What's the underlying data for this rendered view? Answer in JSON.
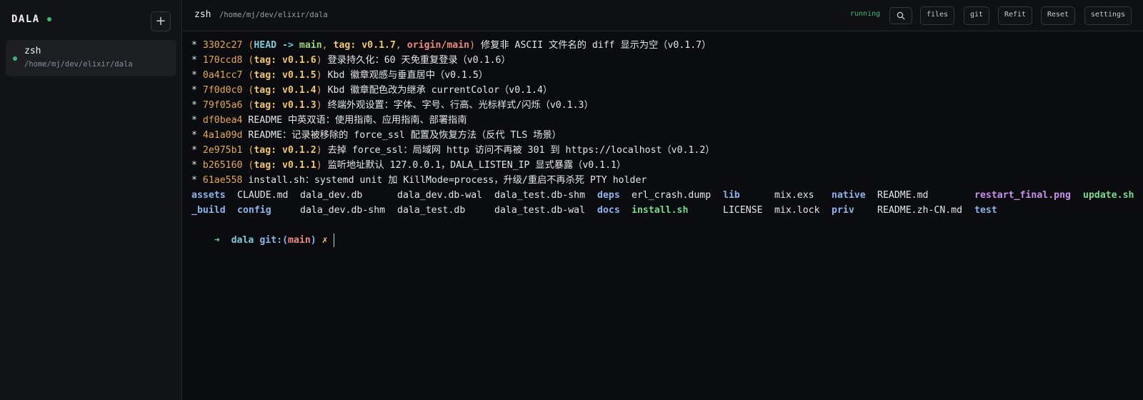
{
  "sidebar": {
    "brand": "DALA",
    "add_label": "+",
    "sessions": [
      {
        "name": "zsh",
        "path": "/home/mj/dev/elixir/dala"
      }
    ]
  },
  "header": {
    "title": "zsh",
    "path": "/home/mj/dev/elixir/dala",
    "status": "running",
    "buttons": {
      "files": "files",
      "git": "git",
      "refit": "Refit",
      "reset": "Reset",
      "settings": "settings"
    }
  },
  "terminal": {
    "log": [
      {
        "star": "* ",
        "hash": "3302c27",
        "refs": [
          {
            "text": " (",
            "cls": "p"
          },
          {
            "text": "HEAD -> ",
            "cls": "c"
          },
          {
            "text": "main",
            "cls": "g"
          },
          {
            "text": ", ",
            "cls": "p"
          },
          {
            "text": "tag: v0.1.7",
            "cls": "t"
          },
          {
            "text": ", ",
            "cls": "p"
          },
          {
            "text": "origin/main",
            "cls": "r"
          },
          {
            "text": ")",
            "cls": "p"
          }
        ],
        "msg": " 修复非 ASCII 文件名的 diff 显示为空（v0.1.7）"
      },
      {
        "star": "* ",
        "hash": "170ccd8",
        "refs": [
          {
            "text": " (",
            "cls": "p"
          },
          {
            "text": "tag: v0.1.6",
            "cls": "t"
          },
          {
            "text": ")",
            "cls": "p"
          }
        ],
        "msg": " 登录持久化：60 天免重复登录（v0.1.6）"
      },
      {
        "star": "* ",
        "hash": "0a41cc7",
        "refs": [
          {
            "text": " (",
            "cls": "p"
          },
          {
            "text": "tag: v0.1.5",
            "cls": "t"
          },
          {
            "text": ")",
            "cls": "p"
          }
        ],
        "msg": " Kbd 徽章观感与垂直居中（v0.1.5）"
      },
      {
        "star": "* ",
        "hash": "7f0d0c0",
        "refs": [
          {
            "text": " (",
            "cls": "p"
          },
          {
            "text": "tag: v0.1.4",
            "cls": "t"
          },
          {
            "text": ")",
            "cls": "p"
          }
        ],
        "msg": " Kbd 徽章配色改为继承 currentColor（v0.1.4）"
      },
      {
        "star": "* ",
        "hash": "79f05a6",
        "refs": [
          {
            "text": " (",
            "cls": "p"
          },
          {
            "text": "tag: v0.1.3",
            "cls": "t"
          },
          {
            "text": ")",
            "cls": "p"
          }
        ],
        "msg": " 终端外观设置：字体、字号、行高、光标样式/闪烁（v0.1.3）"
      },
      {
        "star": "* ",
        "hash": "df0bea4",
        "refs": [],
        "msg": " README 中英双语：使用指南、应用指南、部署指南"
      },
      {
        "star": "* ",
        "hash": "4a1a09d",
        "refs": [],
        "msg": " README：记录被移除的 force_ssl 配置及恢复方法（反代 TLS 场景）"
      },
      {
        "star": "* ",
        "hash": "2e975b1",
        "refs": [
          {
            "text": " (",
            "cls": "p"
          },
          {
            "text": "tag: v0.1.2",
            "cls": "t"
          },
          {
            "text": ")",
            "cls": "p"
          }
        ],
        "msg": " 去掉 force_ssl：局域网 http 访问不再被 301 到 https://localhost（v0.1.2）"
      },
      {
        "star": "* ",
        "hash": "b265160",
        "refs": [
          {
            "text": " (",
            "cls": "p"
          },
          {
            "text": "tag: v0.1.1",
            "cls": "t"
          },
          {
            "text": ")",
            "cls": "p"
          }
        ],
        "msg": " 监听地址默认 127.0.0.1，DALA_LISTEN_IP 显式暴露（v0.1.1）"
      },
      {
        "star": "* ",
        "hash": "61ae558",
        "refs": [],
        "msg": " install.sh：systemd unit 加 KillMode=process，升级/重启不再杀死 PTY holder"
      }
    ],
    "ls_rows": [
      [
        {
          "text": "assets",
          "cls": "b"
        },
        {
          "text": "CLAUDE.md",
          "cls": "w"
        },
        {
          "text": "dala_dev.db",
          "cls": "w"
        },
        {
          "text": "dala_dev.db-wal",
          "cls": "w"
        },
        {
          "text": "dala_test.db-shm",
          "cls": "w"
        },
        {
          "text": "deps",
          "cls": "b"
        },
        {
          "text": "erl_crash.dump",
          "cls": "w"
        },
        {
          "text": "lib",
          "cls": "b"
        },
        {
          "text": "mix.exs",
          "cls": "w"
        },
        {
          "text": "native",
          "cls": "b"
        },
        {
          "text": "README.md",
          "cls": "w"
        },
        {
          "text": "restart_final.png",
          "cls": "m"
        },
        {
          "text": "update.sh",
          "cls": "gr"
        }
      ],
      [
        {
          "text": "_build",
          "cls": "b"
        },
        {
          "text": "config",
          "cls": "b"
        },
        {
          "text": "dala_dev.db-shm",
          "cls": "w"
        },
        {
          "text": "dala_test.db",
          "cls": "w"
        },
        {
          "text": "dala_test.db-wal",
          "cls": "w"
        },
        {
          "text": "docs",
          "cls": "b"
        },
        {
          "text": "install.sh",
          "cls": "gr"
        },
        {
          "text": "LICENSE",
          "cls": "w"
        },
        {
          "text": "mix.lock",
          "cls": "w"
        },
        {
          "text": "priv",
          "cls": "b"
        },
        {
          "text": "README.zh-CN.md",
          "cls": "w"
        },
        {
          "text": "test",
          "cls": "b"
        },
        {
          "text": "",
          "cls": "w"
        }
      ]
    ],
    "prompt": {
      "arrow": "➜",
      "dir": "dala",
      "git_prefix": "git:(",
      "branch": "main",
      "git_suffix": ")",
      "dirty": "✗"
    }
  },
  "colors": {
    "accent_green": "#3fb96f",
    "background": "#0b0c0f",
    "hash": "#e5a85a",
    "tag": "#f0c674",
    "dir": "#8fb3ea"
  }
}
